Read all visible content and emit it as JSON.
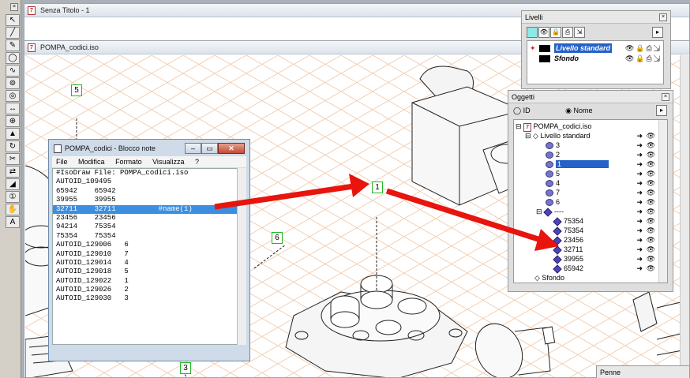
{
  "doc1": {
    "title": "Senza Titolo - 1"
  },
  "doc2": {
    "title": "POMPA_codici.iso"
  },
  "callouts": [
    "5",
    "1",
    "6",
    "3"
  ],
  "notepad": {
    "title": "POMPA_codici - Blocco note",
    "menu": [
      "File",
      "Modifica",
      "Formato",
      "Visualizza",
      "?"
    ],
    "lines": [
      "#IsoDraw File: POMPA_codici.iso",
      "AUTOID_109495",
      "65942    65942",
      "39955    39955",
      "32711    32711          #name(1)",
      "23456    23456",
      "94214    75354",
      "75354    75354",
      "AUTOID_129006   6",
      "AUTOID_129010   7",
      "AUTOID_129014   4",
      "AUTOID_129018   5",
      "AUTOID_129022   1",
      "AUTOID_129026   2",
      "AUTOID_129030   3"
    ]
  },
  "livelli": {
    "title": "Livelli",
    "layers": [
      {
        "name": "Livello standard",
        "selected": true
      },
      {
        "name": "Sfondo",
        "selected": false
      }
    ]
  },
  "oggetti": {
    "title": "Oggetti",
    "radio_id": "ID",
    "radio_nome": "Nome",
    "tree": [
      {
        "label": "POMPA_codici.iso",
        "kind": "file"
      },
      {
        "label": "Livello standard",
        "kind": "layer"
      },
      {
        "label": "3",
        "kind": "item"
      },
      {
        "label": "2",
        "kind": "item"
      },
      {
        "label": "1",
        "kind": "item",
        "selected": true
      },
      {
        "label": "5",
        "kind": "item"
      },
      {
        "label": "4",
        "kind": "item"
      },
      {
        "label": "7",
        "kind": "item"
      },
      {
        "label": "6",
        "kind": "item"
      },
      {
        "label": "----",
        "kind": "group"
      },
      {
        "label": "75354",
        "kind": "part"
      },
      {
        "label": "75354",
        "kind": "part"
      },
      {
        "label": "23456",
        "kind": "part"
      },
      {
        "label": "32711",
        "kind": "part"
      },
      {
        "label": "39955",
        "kind": "part"
      },
      {
        "label": "65942",
        "kind": "part"
      },
      {
        "label": "Sfondo",
        "kind": "layer"
      }
    ]
  },
  "penne": {
    "title": "Penne"
  },
  "colors": {
    "arrow": "#e8140e",
    "callout_border": "#24b524",
    "selection": "#2461c8"
  }
}
